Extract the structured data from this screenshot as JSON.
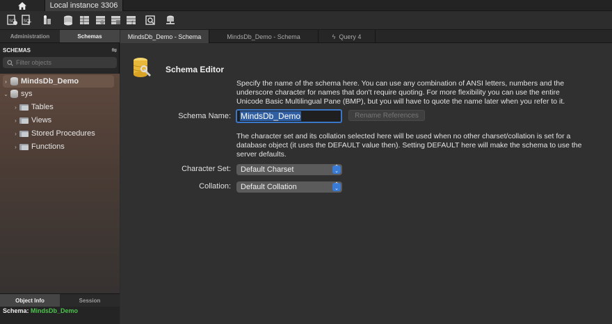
{
  "top_tabs": {
    "home_icon": "home-icon",
    "connection_tab": "Local instance 3306"
  },
  "toolbar": {
    "icons": [
      "new-sql-file-icon",
      "open-sql-file-icon",
      "inspector-icon",
      "create-schema-icon",
      "create-table-icon",
      "create-view-icon",
      "create-procedure-icon",
      "create-function-icon",
      "search-table-data-icon",
      "reconnect-icon"
    ]
  },
  "sidebar": {
    "tabs": [
      "Administration",
      "Schemas"
    ],
    "active_tab": "Schemas",
    "header": "SCHEMAS",
    "filter_placeholder": "Filter objects",
    "tree": [
      {
        "label": "MindsDb_Demo",
        "selected": true,
        "expanded": false
      },
      {
        "label": "sys",
        "selected": false,
        "expanded": true
      },
      {
        "label": "Tables"
      },
      {
        "label": "Views"
      },
      {
        "label": "Stored Procedures"
      },
      {
        "label": "Functions"
      }
    ],
    "bottom_tabs": [
      "Object Info",
      "Session"
    ],
    "info_key": "Schema:",
    "info_value": "MindsDb_Demo"
  },
  "doc_tabs": [
    {
      "label": "MindsDb_Demo - Schema",
      "active": true
    },
    {
      "label": "MindsDb_Demo - Schema",
      "active": false
    },
    {
      "label": "Query 4",
      "active": false,
      "icon": "lightning-icon"
    }
  ],
  "editor": {
    "title": "Schema Editor",
    "name_help": [
      "Specify the name of the schema here. You can use any combination of ANSI letters, numbers and the",
      "underscore character for names that don't require quoting. For more flexibility you can use the entire",
      "Unicode Basic Multilingual Pane (BMP), but you will have to quote the name later when you refer to it."
    ],
    "name_label": "Schema Name:",
    "name_value": "MindsDb_Demo",
    "rename_button": "Rename References",
    "charset_help": [
      "The character set and its collation selected here will be used when no other charset/collation is set for a",
      "database object (it uses the DEFAULT value then). Setting DEFAULT here will make the schema to use the",
      "server defaults."
    ],
    "charset_label": "Character Set:",
    "charset_value": "Default Charset",
    "collation_label": "Collation:",
    "collation_value": "Default Collation"
  },
  "colors": {
    "accent": "#3a7bd5",
    "schema_name_info": "#4ec34e"
  }
}
